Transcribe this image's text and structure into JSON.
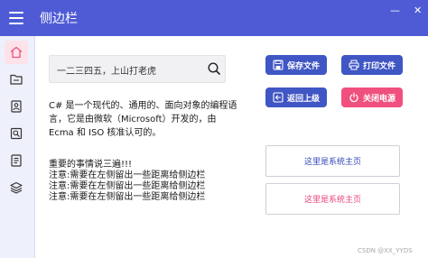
{
  "window": {
    "title": "侧边栏",
    "minimize": "—",
    "close": "✕"
  },
  "sidebar": {
    "items": [
      {
        "icon": "home-icon"
      },
      {
        "icon": "folder-icon"
      },
      {
        "icon": "user-card-icon"
      },
      {
        "icon": "search-doc-icon"
      },
      {
        "icon": "note-icon"
      },
      {
        "icon": "layers-icon"
      }
    ]
  },
  "search": {
    "value": "一二三四五，上山打老虎",
    "icon": "search-icon"
  },
  "description": {
    "line1": "C# 是一个现代的、通用的、面向对象的编程语",
    "line2": "言，它是由微软（Microsoft）开发的，由",
    "line3": "Ecma 和 ISO 核准认可的。"
  },
  "notes": {
    "heading": "重要的事情说三遍!!!",
    "items": [
      "注意:需要在左侧留出一些距离给侧边栏",
      "注意:需要在左侧留出一些距离给侧边栏",
      "注意:需要在左侧留出一些距离给侧边栏"
    ]
  },
  "buttons": {
    "save": "保存文件",
    "print": "打印文件",
    "back": "返回上级",
    "shutdown": "关闭电源"
  },
  "panels": {
    "primary": "这里是系统主页",
    "secondary": "这里是系统主页"
  },
  "colors": {
    "accent": "#4f5bd5",
    "button_blue": "#4056c4",
    "button_red": "#f0507e",
    "panel_text_blue": "#3346b8",
    "panel_text_red": "#e8457a"
  },
  "watermark": "CSDN @XX_YYDS"
}
